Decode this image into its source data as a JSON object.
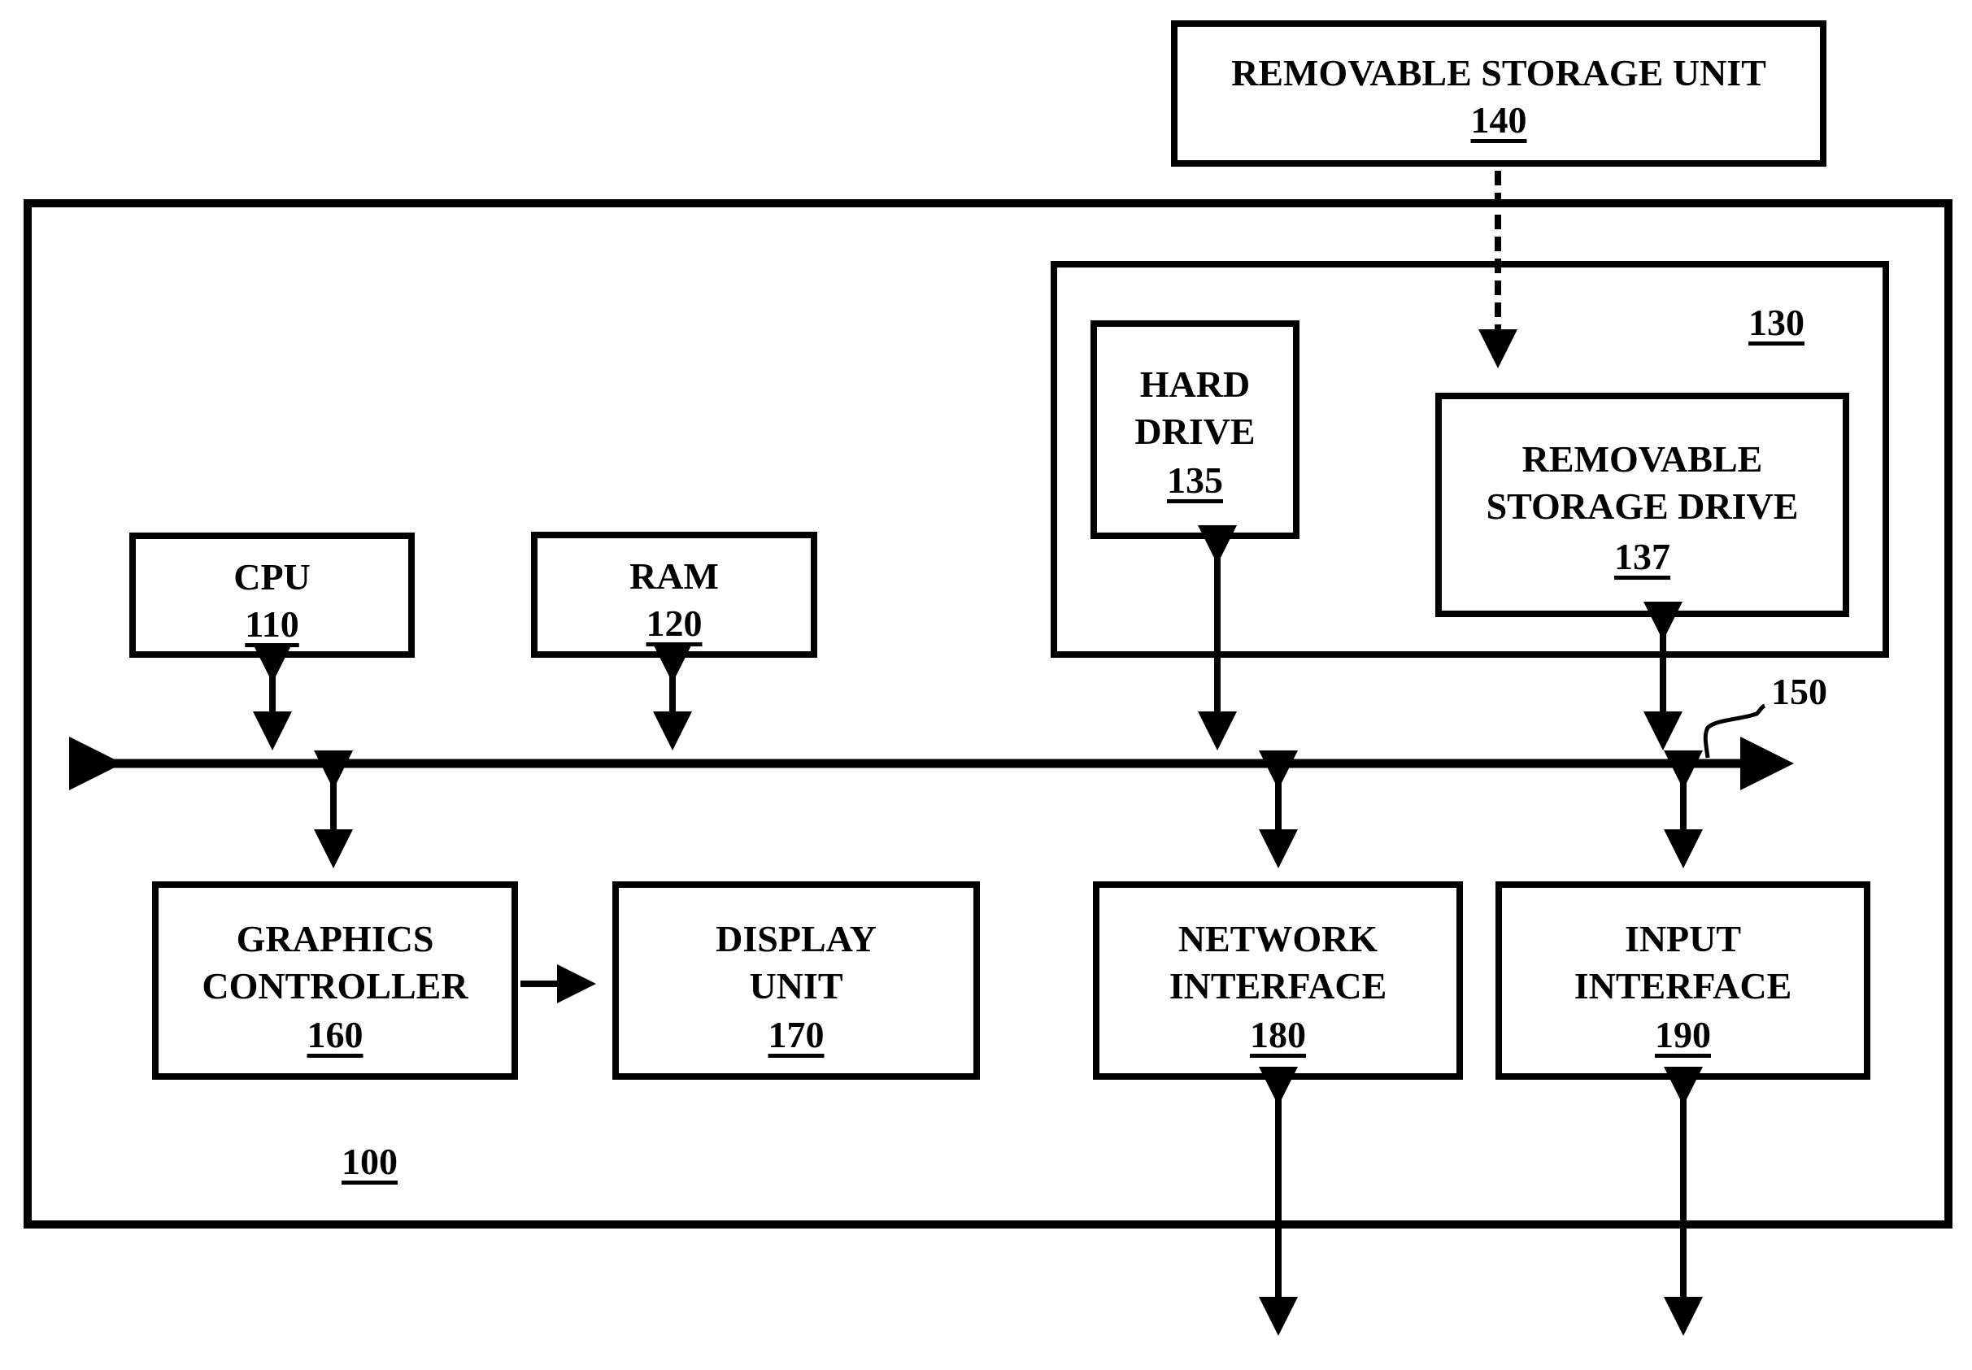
{
  "diagram": {
    "system": {
      "ref": "100"
    },
    "storage_group": {
      "ref": "130"
    },
    "bus": {
      "ref": "150"
    },
    "blocks": {
      "removable_storage_unit": {
        "line1": "REMOVABLE STORAGE UNIT",
        "ref": "140"
      },
      "hard_drive": {
        "line1": "HARD",
        "line2": "DRIVE",
        "ref": "135"
      },
      "removable_storage_drive": {
        "line1": "REMOVABLE",
        "line2": "STORAGE DRIVE",
        "ref": "137"
      },
      "cpu": {
        "line1": "CPU",
        "ref": "110"
      },
      "ram": {
        "line1": "RAM",
        "ref": "120"
      },
      "graphics_controller": {
        "line1": "GRAPHICS",
        "line2": "CONTROLLER",
        "ref": "160"
      },
      "display_unit": {
        "line1": "DISPLAY",
        "line2": "UNIT",
        "ref": "170"
      },
      "network_interface": {
        "line1": "NETWORK",
        "line2": "INTERFACE",
        "ref": "180"
      },
      "input_interface": {
        "line1": "INPUT",
        "line2": "INTERFACE",
        "ref": "190"
      }
    },
    "connections": [
      {
        "from": "removable_storage_unit",
        "to": "removable_storage_drive",
        "style": "dashed",
        "direction": "one-way"
      },
      {
        "from": "cpu",
        "to": "bus",
        "direction": "two-way"
      },
      {
        "from": "ram",
        "to": "bus",
        "direction": "two-way"
      },
      {
        "from": "hard_drive",
        "to": "bus",
        "direction": "two-way"
      },
      {
        "from": "removable_storage_drive",
        "to": "bus",
        "direction": "two-way"
      },
      {
        "from": "graphics_controller",
        "to": "bus",
        "direction": "two-way"
      },
      {
        "from": "network_interface",
        "to": "bus",
        "direction": "two-way"
      },
      {
        "from": "input_interface",
        "to": "bus",
        "direction": "two-way"
      },
      {
        "from": "graphics_controller",
        "to": "display_unit",
        "direction": "one-way"
      },
      {
        "from": "network_interface",
        "to": "external",
        "direction": "two-way"
      },
      {
        "from": "input_interface",
        "to": "external",
        "direction": "two-way"
      }
    ]
  }
}
